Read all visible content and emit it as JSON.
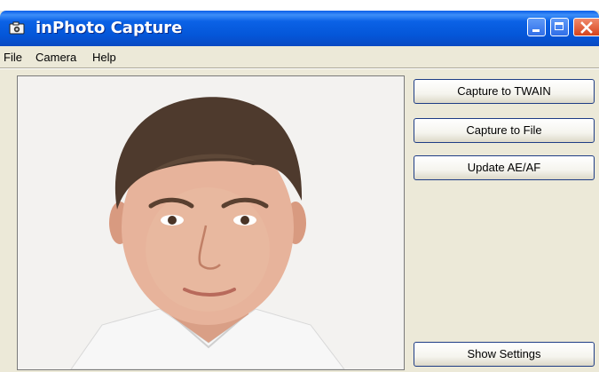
{
  "window": {
    "title": "inPhoto Capture",
    "app_icon": "camera-icon",
    "controls": [
      "minimize-icon",
      "maximize-icon",
      "close-icon"
    ]
  },
  "menu": {
    "items": [
      {
        "label": "File"
      },
      {
        "label": "Camera"
      },
      {
        "label": "Help"
      }
    ]
  },
  "buttons": {
    "capture_twain": "Capture to TWAIN",
    "capture_file": "Capture to File",
    "update_ae_af": "Update AE/AF",
    "show_settings": "Show Settings"
  },
  "preview": {
    "content": "live camera preview"
  },
  "colors": {
    "title_bar": "#0a5ee8",
    "window_bg": "#ece9d8",
    "close_button": "#d6431c",
    "button_border": "#1f3d85"
  }
}
